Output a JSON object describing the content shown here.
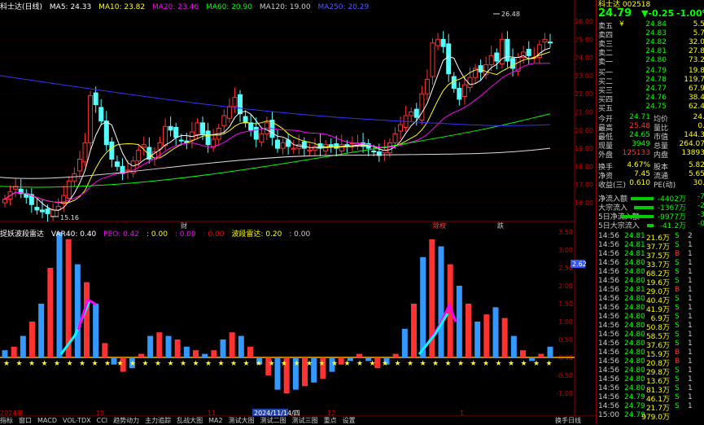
{
  "header": {
    "stock": "科士达(日线)",
    "ma_label": "MA5: 24.33",
    "ma10": "MA10: 23.82",
    "ma20": "MA20: 23.46",
    "ma60": "MA60: 20.90",
    "ma120": "MA120: 19.00",
    "ma250": "MA250: 20.29"
  },
  "colors": {
    "up": "#ff3232",
    "down": "#54ffff",
    "ma5": "#ffffff",
    "ma10": "#ffff00",
    "ma20": "#ff00ff",
    "ma60": "#00ff00",
    "ma120": "#ffffff",
    "ma250": "#0000ff"
  },
  "price_axis": [
    "26.00",
    "25.00",
    "24.00",
    "23.00",
    "22.00",
    "21.00",
    "20.00",
    "19.00",
    "18.00",
    "17.00",
    "16.00"
  ],
  "price_annotations": {
    "high": "26.48",
    "low": "15.16"
  },
  "markers": {
    "m1": "财",
    "m2": "除权",
    "m3": "跌"
  },
  "indicator": {
    "name": "捉妖波段雷达",
    "var40": "VAR40: 0.40",
    "peo": "PEO: 0.42",
    "a1": ": 0.00",
    "a2": ": 0.00",
    "a3": ": 0.00",
    "label2": "波段雷达: 0.20",
    "a4": ": 0.00",
    "axis": [
      "3.50",
      "3.00",
      "2.50",
      "2.00",
      "1.50",
      "1.00",
      "0.50",
      "0.00",
      "-0.50",
      "-1.00"
    ],
    "current": "2.62"
  },
  "date_labels": {
    "d1": "2024年",
    "d2": "10",
    "d3": "11",
    "d4": "2024/11/14/四",
    "d5": "12",
    "d6": "1"
  },
  "quote": {
    "title": "科士达 002518",
    "price": "24.79",
    "change": "▼-0.25",
    "pct": "-1.00%",
    "asks": [
      {
        "label": "卖五",
        "flag": "¥",
        "price": "24.84",
        "vol": "5.5"
      },
      {
        "label": "卖四",
        "flag": "",
        "price": "24.83",
        "vol": "5.7"
      },
      {
        "label": "卖三",
        "flag": "",
        "price": "24.82",
        "vol": "32.0"
      },
      {
        "label": "卖二",
        "flag": "",
        "price": "24.81",
        "vol": "27.8"
      },
      {
        "label": "卖一",
        "flag": "",
        "price": "24.80",
        "vol": "73.2"
      }
    ],
    "bids": [
      {
        "label": "买一",
        "price": "24.79",
        "vol": "19.8"
      },
      {
        "label": "买二",
        "price": "24.78",
        "vol": "119.7"
      },
      {
        "label": "买三",
        "price": "24.77",
        "vol": "67.9"
      },
      {
        "label": "买四",
        "price": "24.76",
        "vol": "38.4"
      },
      {
        "label": "买五",
        "price": "24.75",
        "vol": "62.4"
      }
    ],
    "stats": [
      {
        "l1": "今开",
        "v1": "24.71",
        "l2": "均价",
        "v2": "24."
      },
      {
        "l1": "最高",
        "v1": "25.48",
        "l2": "量比",
        "v2": "0."
      },
      {
        "l1": "最低",
        "v1": "24.65",
        "l2": "市值",
        "v2": "144.3"
      },
      {
        "l1": "现量",
        "v1": "3949",
        "l2": "总量",
        "v2": "264.07"
      },
      {
        "l1": "外盘",
        "v1": "125133",
        "l2": "内盘",
        "v2": "13893"
      }
    ],
    "stats2": [
      {
        "l1": "换手",
        "v1": "4.67%",
        "l2": "股本",
        "v2": "5.82"
      },
      {
        "l1": "净资",
        "v1": "7.45",
        "l2": "流通",
        "v2": "5.65"
      },
      {
        "l1": "收益(三)",
        "v1": "0.610",
        "l2": "PE(动)",
        "v2": "30."
      }
    ],
    "flows": [
      {
        "label": "净流入额",
        "value": "-4402万",
        "pct": "-7"
      },
      {
        "label": "大宗流入",
        "value": "-1367万",
        "pct": "-2"
      },
      {
        "label": "5日净流入额",
        "value": "-9977万",
        "pct": "-3"
      },
      {
        "label": "5日大宗流入",
        "value": "-41.2万",
        "pct": "-0"
      }
    ]
  },
  "ticks": [
    {
      "t": "14:56",
      "p": "24.81",
      "v": "21.6万",
      "d": "S",
      "e": "2"
    },
    {
      "t": "14:56",
      "p": "24.81",
      "v": "37.7万",
      "d": "S",
      "e": "1"
    },
    {
      "t": "14:56",
      "p": "24.81",
      "v": "37.5万",
      "d": "B",
      "e": "1"
    },
    {
      "t": "14:56",
      "p": "24.80",
      "v": "33.7万",
      "d": "S",
      "e": "1"
    },
    {
      "t": "14:56",
      "p": "24.80",
      "v": "68.2万",
      "d": "S",
      "e": "1"
    },
    {
      "t": "14:56",
      "p": "24.80",
      "v": "19.6万",
      "d": "S",
      "e": "1"
    },
    {
      "t": "14:56",
      "p": "24.81",
      "v": "29.0万",
      "d": "B",
      "e": "1"
    },
    {
      "t": "14:56",
      "p": "24.80",
      "v": "40.4万",
      "d": "S",
      "e": "1"
    },
    {
      "t": "14:56",
      "p": "24.80",
      "v": "41.9万",
      "d": "S",
      "e": "1"
    },
    {
      "t": "14:56",
      "p": "24.80",
      "v": "6.9万",
      "d": "S",
      "e": "1"
    },
    {
      "t": "14:56",
      "p": "24.80",
      "v": "50.8万",
      "d": "S",
      "e": "1"
    },
    {
      "t": "14:56",
      "p": "24.80",
      "v": "58.5万",
      "d": "S",
      "e": "1"
    },
    {
      "t": "14:56",
      "p": "24.80",
      "v": "37.6万",
      "d": "S",
      "e": "1"
    },
    {
      "t": "14:56",
      "p": "24.80",
      "v": "15.9万",
      "d": "B",
      "e": "1"
    },
    {
      "t": "14:56",
      "p": "24.80",
      "v": "20.8万",
      "d": "B",
      "e": "1"
    },
    {
      "t": "14:56",
      "p": "24.80",
      "v": "29.8万",
      "d": "S",
      "e": "1"
    },
    {
      "t": "14:56",
      "p": "24.80",
      "v": "13.6万",
      "d": "S",
      "e": "1"
    },
    {
      "t": "14:56",
      "p": "24.80",
      "v": "81.3万",
      "d": "S",
      "e": "1"
    },
    {
      "t": "14:56",
      "p": "24.79",
      "v": "46.1万",
      "d": "S",
      "e": "1"
    },
    {
      "t": "14:56",
      "p": "24.79",
      "v": "21.7万",
      "d": "S",
      "e": "1"
    },
    {
      "t": "15:00",
      "p": "24.79",
      "v": "979.0万",
      "d": "",
      "e": ""
    }
  ],
  "bottom_tabs": [
    "指标",
    "窗口",
    "MACD",
    "VOL-TDX",
    "CCI",
    "趋势动力",
    "主力追踪",
    "乱战大图",
    "MA2",
    "测试大图",
    "测试二图",
    "测试三图",
    "重点",
    "设置"
  ],
  "bottom_right": [
    "换手",
    "日线"
  ]
}
